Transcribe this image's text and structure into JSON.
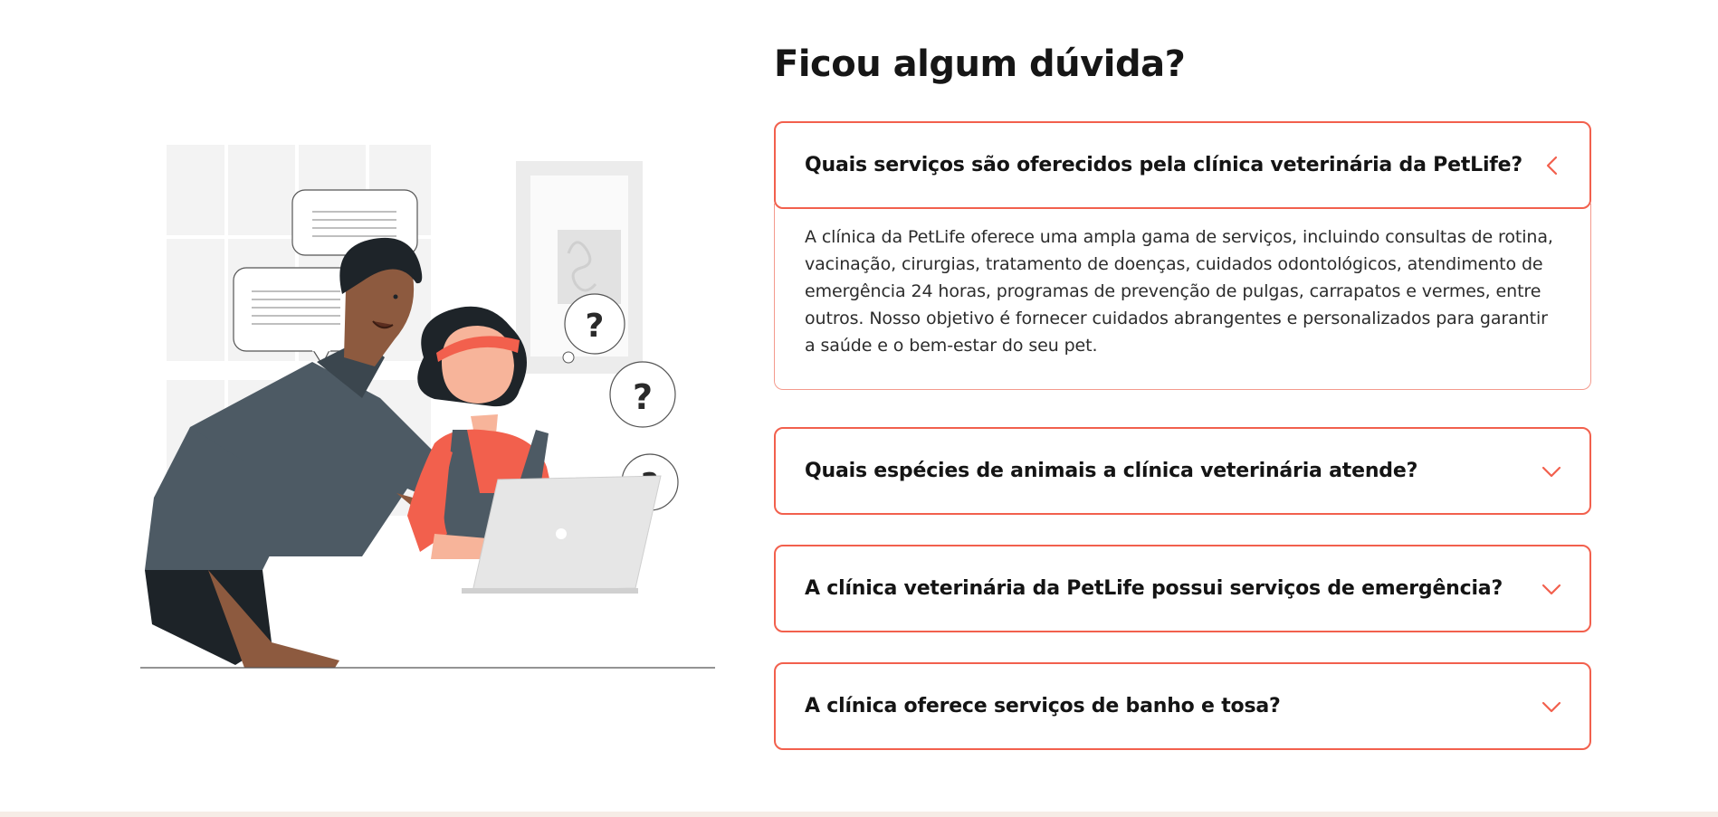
{
  "faq": {
    "title": "Ficou algum dúvida?",
    "accent_color": "#f2604d",
    "items": [
      {
        "question": "Quais serviços são oferecidos pela clínica veterinária da PetLife?",
        "answer": "A clínica da PetLife oferece uma ampla gama de serviços, incluindo consultas de rotina, vacinação, cirurgias, tratamento de doenças, cuidados odontológicos, atendimento de emergência 24 horas, programas de prevenção de pulgas, carrapatos e vermes, entre outros. Nosso objetivo é fornecer cuidados abrangentes e personalizados para garantir a saúde e o bem-estar do seu pet.",
        "expanded": true,
        "icon": "chevron-left-icon"
      },
      {
        "question": "Quais espécies de animais a clínica veterinária atende?",
        "expanded": false,
        "icon": "chevron-down-icon"
      },
      {
        "question": "A clínica veterinária da PetLife possui serviços de emergência?",
        "expanded": false,
        "icon": "chevron-down-icon"
      },
      {
        "question": "A clínica oferece serviços de banho e tosa?",
        "expanded": false,
        "icon": "chevron-down-icon"
      }
    ]
  },
  "illustration": {
    "question_mark": "?"
  }
}
